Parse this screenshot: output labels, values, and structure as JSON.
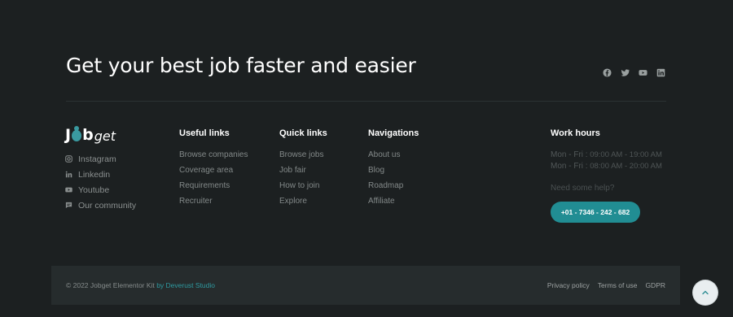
{
  "hero": {
    "title": "Get your best job faster and easier"
  },
  "social_icons": [
    "facebook-icon",
    "twitter-icon",
    "youtube-icon",
    "linkedin-icon"
  ],
  "brand": {
    "logo_text_bold_1": "J",
    "logo_text_bold_2": "b",
    "logo_text_italic": "get",
    "links": [
      {
        "label": "Instagram",
        "icon": "instagram-icon"
      },
      {
        "label": "Linkedin",
        "icon": "linkedin-icon"
      },
      {
        "label": "Youtube",
        "icon": "youtube-icon"
      },
      {
        "label": "Our community",
        "icon": "chat-icon"
      }
    ]
  },
  "columns": [
    {
      "heading": "Useful links",
      "links": [
        "Browse companies",
        "Coverage area",
        "Requirements",
        "Recruiter"
      ]
    },
    {
      "heading": "Quick links",
      "links": [
        "Browse jobs",
        "Job fair",
        "How to join",
        "Explore"
      ]
    },
    {
      "heading": "Navigations",
      "links": [
        "About us",
        "Blog",
        "Roadmap",
        "Affiliate"
      ]
    }
  ],
  "work_hours": {
    "heading": "Work hours",
    "rows": [
      {
        "days": "Mon - Fri :",
        "hours": "09:00 AM - 19:00 AM"
      },
      {
        "days": "Mon - Fri :",
        "hours": "08:00 AM - 20:00 AM"
      }
    ],
    "help_text": "Need some help?",
    "phone": "+01 - 7346 - 242 - 682"
  },
  "footer": {
    "copyright": "© 2022 Jobget Elementor Kit",
    "by_text": "by Deverust Studio",
    "legal_links": [
      "Privacy policy",
      "Terms of use",
      "GDPR"
    ]
  },
  "colors": {
    "background": "#1c2021",
    "accent": "#218d93",
    "bar": "#262c2d"
  }
}
